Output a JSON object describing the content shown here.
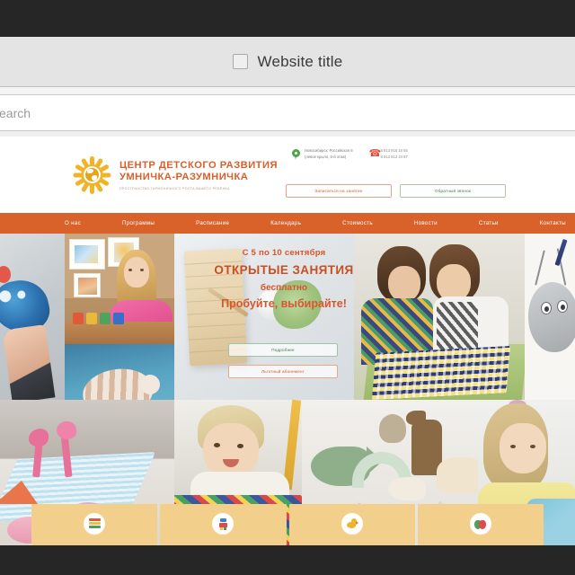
{
  "browser": {
    "tab_title": "Website title",
    "tab_checkbox_name": "tab-checkbox",
    "url_placeholder": "search",
    "url_value": "search"
  },
  "site": {
    "brand": {
      "line1": "ЦЕНТР ДЕТСКОГО РАЗВИТИЯ",
      "line2": "УМНИЧКА-РАЗУМНИЧКА",
      "tagline": "ПРОСТРАНСТВО ГАРМОНИЧНОГО РОСТА ВАШЕГО РЕБЁНКА",
      "logo_icon": "sun-globe-icon"
    },
    "contacts": {
      "pin_icon": "map-pin-icon",
      "phone_icon": "phone-icon",
      "address_line1": "Новосибирск, Российская 8",
      "address_line2": "(левое крыло, 5-й этаж)",
      "phone1": "8 913 916 16 55",
      "phone2": "8 913 912 24 87"
    },
    "header_buttons": {
      "signup": "Записаться на занятие",
      "callback": "Обратный звонок"
    },
    "nav": [
      {
        "label": "О нас"
      },
      {
        "label": "Программы"
      },
      {
        "label": "Расписание"
      },
      {
        "label": "Календарь"
      },
      {
        "label": "Стоимость"
      },
      {
        "label": "Новости"
      },
      {
        "label": "Статьи"
      },
      {
        "label": "Контакты"
      }
    ],
    "hero": {
      "line1": "С 5 по 10 сентября",
      "line2": "ОТКРЫТЫЕ ЗАНЯТИЯ",
      "line3": "бесплатно",
      "line4": "Пробуйте, выбирайте!",
      "button_primary": "Подробнее",
      "button_secondary": "Льготный абонемент"
    },
    "tiles": [
      {
        "icon": "books-icon"
      },
      {
        "icon": "robot-icon"
      },
      {
        "icon": "duck-icon"
      },
      {
        "icon": "theater-masks-icon"
      }
    ],
    "colors": {
      "brand_orange": "#d9622b",
      "nav_bar": "#d9622b",
      "tile_tan": "#f2cf8a",
      "chrome_dark": "#262626",
      "accent_green": "#4ca64c",
      "accent_red": "#e04b3a"
    }
  }
}
